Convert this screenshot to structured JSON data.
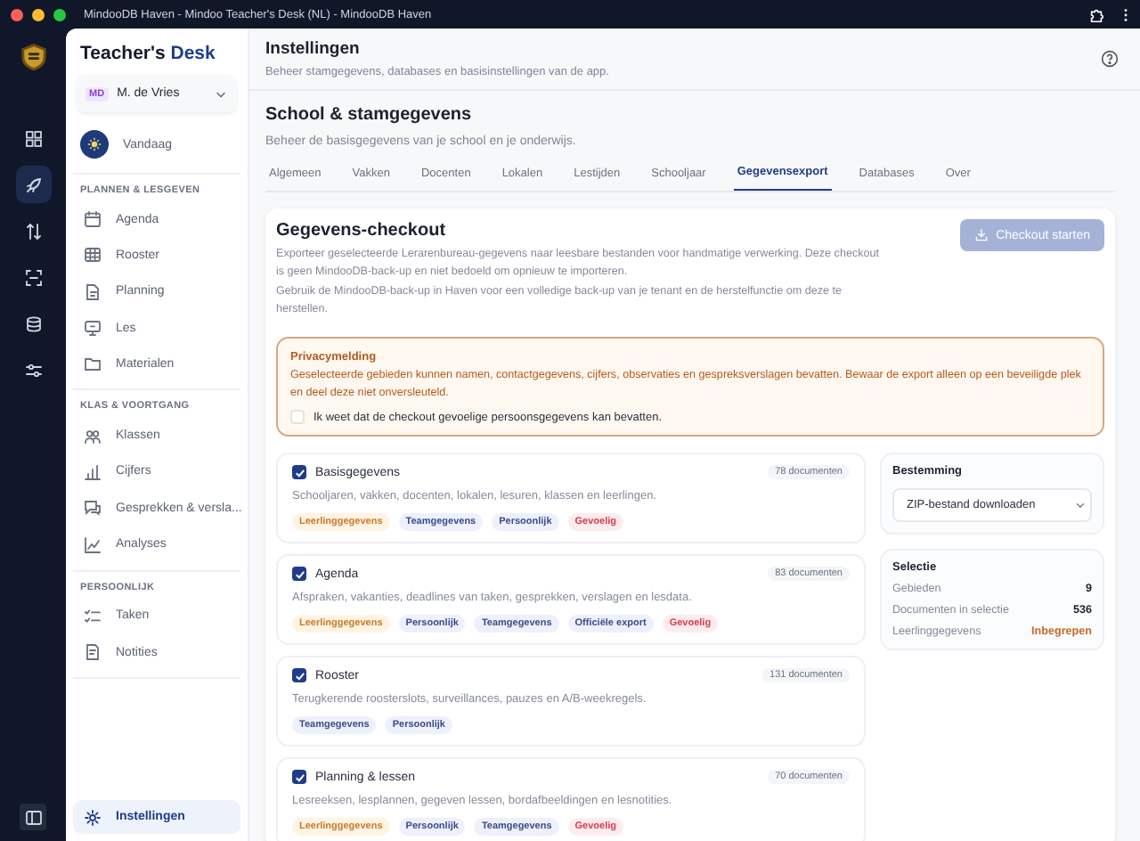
{
  "window": {
    "title": "MindooDB Haven - Mindoo Teacher's Desk (NL) - MindooDB Haven"
  },
  "rail": [
    {
      "selected": false
    },
    {
      "selected": true
    },
    {
      "selected": false
    },
    {
      "selected": false
    },
    {
      "selected": false
    },
    {
      "selected": false
    }
  ],
  "sidebar": {
    "brand": [
      "Teacher's ",
      "Desk"
    ],
    "user": {
      "initials": "MD",
      "name": "M. de Vries"
    },
    "today": "Vandaag",
    "sections": [
      {
        "title": "PLANNEN & LESGEVEN",
        "items": [
          {
            "label": "Agenda"
          },
          {
            "label": "Rooster"
          },
          {
            "label": "Planning"
          },
          {
            "label": "Les"
          },
          {
            "label": "Materialen"
          }
        ]
      },
      {
        "title": "KLAS & VOORTGANG",
        "items": [
          {
            "label": "Klassen"
          },
          {
            "label": "Cijfers"
          },
          {
            "label": "Gesprekken & versla..."
          },
          {
            "label": "Analyses"
          }
        ]
      },
      {
        "title": "PERSOONLIJK",
        "items": [
          {
            "label": "Taken"
          },
          {
            "label": "Notities"
          }
        ]
      }
    ],
    "settings": {
      "label": "Instellingen",
      "selected": true
    }
  },
  "header": {
    "title": "Instellingen",
    "subtitle": "Beheer stamgegevens, databases en basisinstellingen van de app."
  },
  "section": {
    "title": "School & stamgegevens",
    "subtitle": "Beheer de basisgegevens van je school en je onderwijs."
  },
  "tabs": [
    {
      "label": "Algemeen",
      "selected": false
    },
    {
      "label": "Vakken",
      "selected": false
    },
    {
      "label": "Docenten",
      "selected": false
    },
    {
      "label": "Lokalen",
      "selected": false
    },
    {
      "label": "Lestijden",
      "selected": false
    },
    {
      "label": "Schooljaar",
      "selected": false
    },
    {
      "label": "Gegevensexport",
      "selected": true
    },
    {
      "label": "Databases",
      "selected": false
    },
    {
      "label": "Over",
      "selected": false
    }
  ],
  "checkout": {
    "title": "Gegevens-checkout",
    "button": {
      "label": "Checkout starten",
      "disabled": true
    },
    "paragraphs": [
      "Exporteer geselecteerde Lerarenbureau-gegevens naar leesbare bestanden voor handmatige verwerking. Deze checkout is geen MindooDB-back-up en niet bedoeld om opnieuw te importeren.",
      "Gebruik de MindooDB-back-up in Haven voor een volledige back-up van je tenant en de herstelfunctie om deze te herstellen."
    ],
    "privacy": {
      "title": "Privacymelding",
      "text": "Geselecteerde gebieden kunnen namen, contactgegevens, cijfers, observaties en gespreksverslagen bevatten. Bewaar de export alleen op een beveiligde plek en deel deze niet onversleuteld.",
      "consent": "Ik weet dat de checkout gevoelige persoonsgegevens kan bevatten.",
      "checked": false
    },
    "areas": [
      {
        "name": "Basisgegevens",
        "count": "78 documenten",
        "checked": true,
        "description": "Schooljaren, vakken, docenten, lokalen, lesuren, klassen en leerlingen.",
        "tags": [
          {
            "label": "Leerlinggegevens",
            "kind": "student"
          },
          {
            "label": "Teamgegevens",
            "kind": "info"
          },
          {
            "label": "Persoonlijk",
            "kind": "info"
          },
          {
            "label": "Gevoelig",
            "kind": "sensitive"
          }
        ]
      },
      {
        "name": "Agenda",
        "count": "83 documenten",
        "checked": true,
        "description": "Afspraken, vakanties, deadlines van taken, gesprekken, verslagen en lesdata.",
        "tags": [
          {
            "label": "Leerlinggegevens",
            "kind": "student"
          },
          {
            "label": "Persoonlijk",
            "kind": "info"
          },
          {
            "label": "Teamgegevens",
            "kind": "info"
          },
          {
            "label": "Officiële export",
            "kind": "info"
          },
          {
            "label": "Gevoelig",
            "kind": "sensitive"
          }
        ]
      },
      {
        "name": "Rooster",
        "count": "131 documenten",
        "checked": true,
        "description": "Terugkerende roosterslots, surveillances, pauzes en A/B-weekregels.",
        "tags": [
          {
            "label": "Teamgegevens",
            "kind": "info"
          },
          {
            "label": "Persoonlijk",
            "kind": "info"
          }
        ]
      },
      {
        "name": "Planning & lessen",
        "count": "70 documenten",
        "checked": true,
        "description": "Lesreeksen, lesplannen, gegeven lessen, bordafbeeldingen en lesnotities.",
        "tags": [
          {
            "label": "Leerlinggegevens",
            "kind": "student"
          },
          {
            "label": "Persoonlijk",
            "kind": "info"
          },
          {
            "label": "Teamgegevens",
            "kind": "info"
          },
          {
            "label": "Gevoelig",
            "kind": "sensitive"
          }
        ]
      }
    ],
    "destination": {
      "title": "Bestemming",
      "value": "ZIP-bestand downloaden"
    },
    "selection": {
      "title": "Selectie",
      "rows": [
        {
          "label": "Gebieden",
          "value": "9",
          "kind": "plain"
        },
        {
          "label": "Documenten in selectie",
          "value": "536",
          "kind": "plain"
        },
        {
          "label": "Leerlinggegevens",
          "value": "Inbegrepen",
          "kind": "warning"
        }
      ]
    }
  }
}
